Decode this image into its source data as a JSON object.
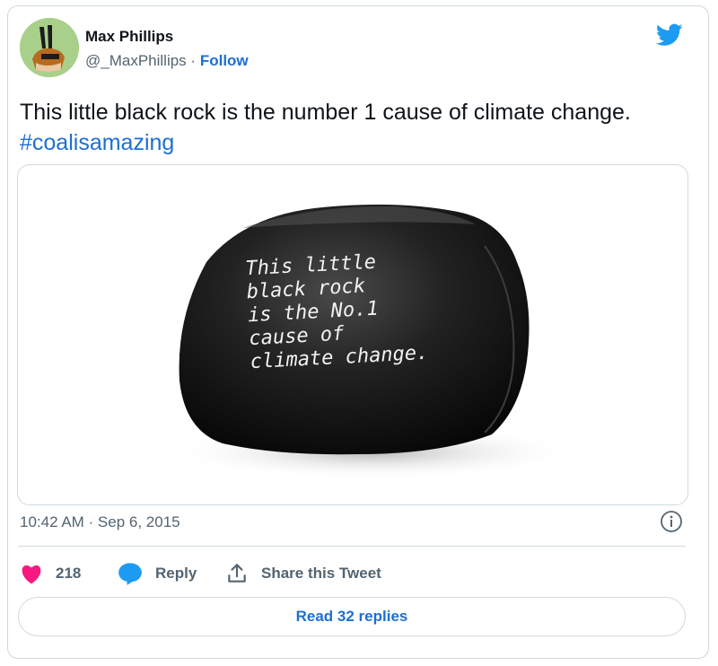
{
  "author": {
    "name": "Max Phillips",
    "handle": "@_MaxPhillips",
    "separator": "·",
    "follow_label": "Follow"
  },
  "tweet": {
    "text": "This little black rock is the number 1 cause of climate change.",
    "hashtag": "#coalisamazing"
  },
  "media": {
    "rock_caption": "This little\nblack rock\nis the No.1\ncause of\nclimate change."
  },
  "meta": {
    "timestamp": "10:42 AM · Sep 6, 2015"
  },
  "actions": {
    "like_count": "218",
    "reply_label": "Reply",
    "share_label": "Share this Tweet"
  },
  "footer": {
    "read_replies_label": "Read 32 replies"
  },
  "colors": {
    "accent": "#1d6fd1",
    "twitter_blue": "#1d9bf0",
    "like_pink": "#f91880",
    "muted": "#536471"
  }
}
